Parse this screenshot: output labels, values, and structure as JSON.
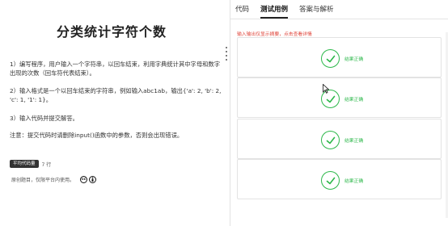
{
  "problem": {
    "title": "分类统计字符个数",
    "paragraphs": [
      "1）编写程序，用户输入一个字符串，以回车结束，利用字典统计其中字母和数字出现的次数（回车符代表结束）。",
      "2）输入格式是一个以回车结束的字符串，例如输入abc1ab，输出{'a': 2, 'b': 2, 'c': 1, '1': 1}。",
      "3）输入代码并提交解答。",
      "注意：提交代码时请删除input()函数中的参数，否则会出现错误。"
    ],
    "meta_label": "平均代码量",
    "meta_value": "7 行",
    "license_text": "原创题目，仅限平台内使用。",
    "license_icons": [
      "cc-icon",
      "by-icon"
    ]
  },
  "tabs": [
    {
      "label": "代码",
      "active": false
    },
    {
      "label": "测试用例",
      "active": true
    },
    {
      "label": "答案与解析",
      "active": false
    }
  ],
  "hint": "输入输出仅显示摘要，点击查看详情",
  "cases": [
    {
      "status": "结果正确"
    },
    {
      "status": "结果正确"
    },
    {
      "status": "结果正确"
    },
    {
      "status": "结果正确"
    }
  ],
  "colors": {
    "success": "#2db84b",
    "hint": "#e0473c"
  }
}
